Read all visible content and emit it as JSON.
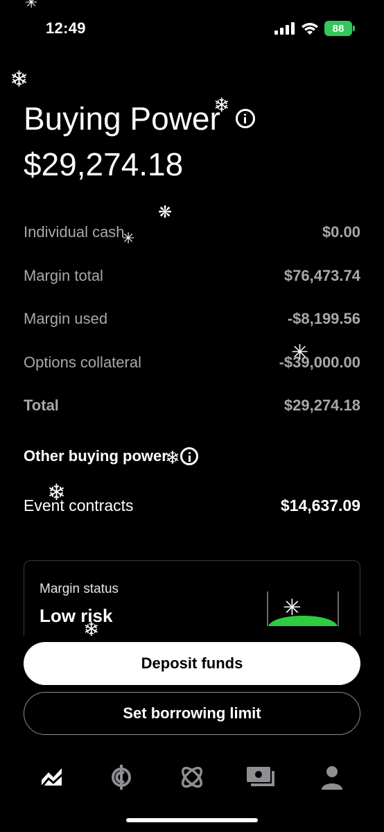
{
  "status_bar": {
    "time": "12:49",
    "battery": "88"
  },
  "header": {
    "title": "Buying Power",
    "amount": "$29,274.18"
  },
  "breakdown": [
    {
      "label": "Individual cash",
      "value": "$0.00"
    },
    {
      "label": "Margin total",
      "value": "$76,473.74"
    },
    {
      "label": "Margin used",
      "value": "-$8,199.56"
    },
    {
      "label": "Options collateral",
      "value": "-$39,000.00"
    },
    {
      "label": "Total",
      "value": "$29,274.18"
    }
  ],
  "other": {
    "title": "Other buying power",
    "event_label": "Event contracts",
    "event_value": "$14,637.09"
  },
  "margin_card": {
    "label": "Margin status",
    "status": "Low risk"
  },
  "buttons": {
    "deposit": "Deposit funds",
    "borrow": "Set borrowing limit"
  },
  "tabs": [
    "chart-icon",
    "crypto-icon",
    "atom-icon",
    "cash-icon",
    "account-icon"
  ],
  "colors": {
    "accent_green": "#2ecc40",
    "battery_green": "#34c759",
    "muted_text": "#a6a8ab"
  }
}
